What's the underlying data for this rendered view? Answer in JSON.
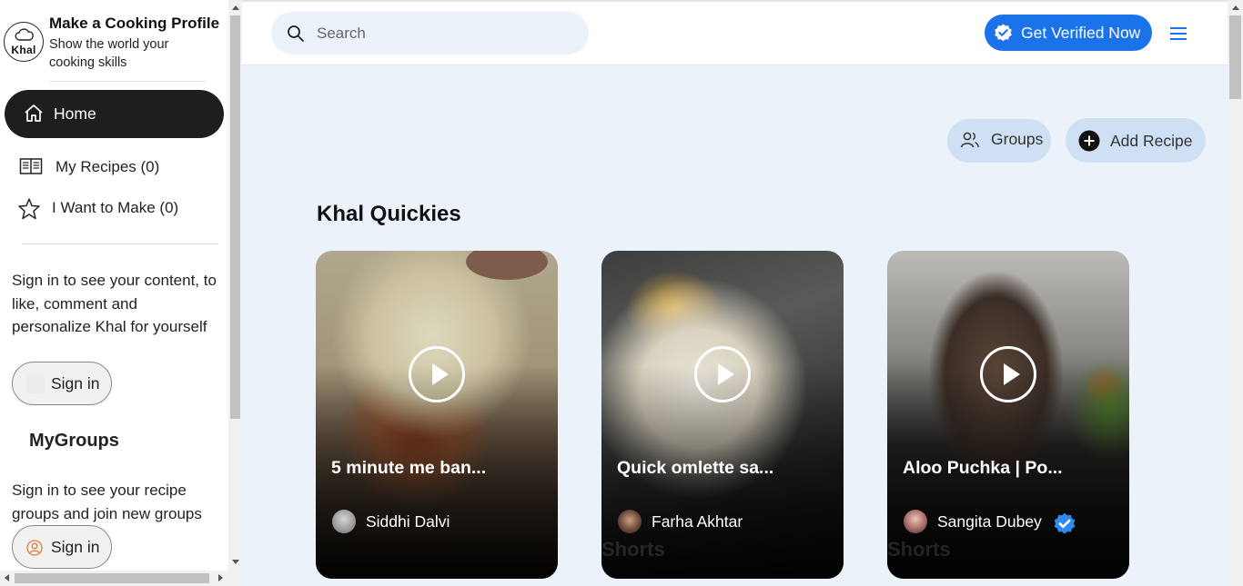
{
  "brand": {
    "logo_text": "Khal",
    "title": "Make a Cooking Profile",
    "subtitle": "Show the world your cooking skills"
  },
  "sidebar": {
    "home_label": "Home",
    "items": [
      {
        "label": "My Recipes (0)",
        "icon": "recipe-book-icon"
      },
      {
        "label": "I Want to Make (0)",
        "icon": "star-icon"
      }
    ],
    "signin_message": "Sign in to see your content, to like, comment and personalize Khal for yourself",
    "signin_label": "Sign in",
    "groups_heading": "MyGroups",
    "groups_message": "Sign in to see your recipe groups and join new groups",
    "groups_signin_label": "Sign in"
  },
  "header": {
    "search_placeholder": "Search",
    "verify_label": "Get Verified Now",
    "accent_color": "#1a73e8"
  },
  "actions": {
    "groups_label": "Groups",
    "add_recipe_label": "Add Recipe"
  },
  "section": {
    "title": "Khal Quickies"
  },
  "cards": [
    {
      "title": "5 minute me ban...",
      "author": "Siddhi Dalvi",
      "verified": false
    },
    {
      "title": "Quick omlette sa...",
      "author": "Farha Akhtar",
      "verified": false,
      "watermark": "Shorts"
    },
    {
      "title": "Aloo Puchka | Po...",
      "author": "Sangita Dubey",
      "verified": true,
      "watermark": "Shorts"
    }
  ]
}
